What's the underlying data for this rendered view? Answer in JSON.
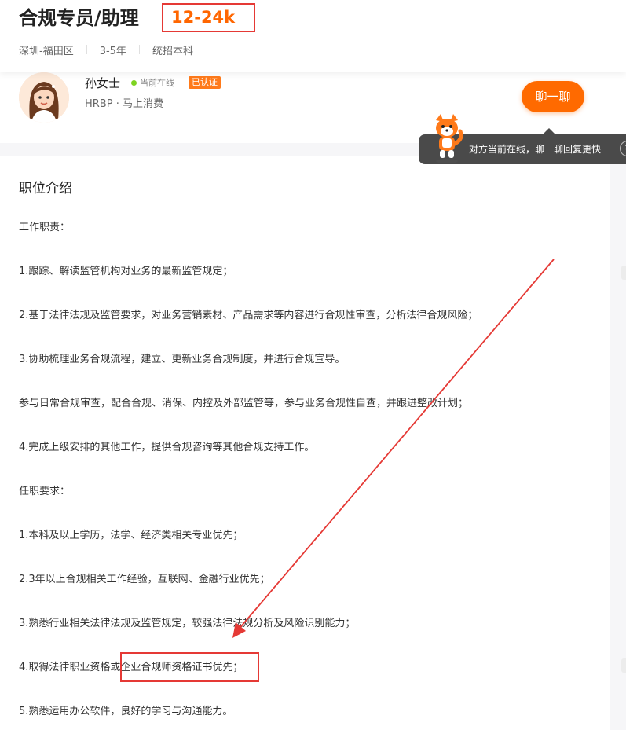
{
  "job": {
    "title": "合规专员/助理",
    "salary": "12-24k",
    "location": "深圳-福田区",
    "experience": "3-5年",
    "education": "统招本科"
  },
  "recruiter": {
    "name": "孙女士",
    "status": "当前在线",
    "verified_badge": "已认证",
    "position_company": "HRBP · 马上消费",
    "chat_button": "聊一聊",
    "tooltip": "对方当前在线，聊一聊回复更快"
  },
  "description": {
    "section_title": "职位介绍",
    "lines": [
      "工作职责：",
      "1.跟踪、解读监管机构对业务的最新监管规定；",
      "2.基于法律法规及监管要求，对业务营销素材、产品需求等内容进行合规性审查，分析法律合规风险；",
      "3.协助梳理业务合规流程，建立、更新业务合规制度，并进行合规宣导。",
      "参与日常合规审查，配合合规、消保、内控及外部监管等，参与业务合规性自查，并跟进整改计划；",
      "4.完成上级安排的其他工作，提供合规咨询等其他合规支持工作。",
      "任职要求：",
      "1.本科及以上学历，法学、经济类相关专业优先；",
      "2.3年以上合规相关工作经验，互联网、金融行业优先；",
      "3.熟悉行业相关法律法规及监管规定，较强法律法规分析及风险识别能力；",
      "4.取得法律职业资格或企业合规师资格证书优先；",
      "5.熟悉运用办公软件，良好的学习与沟通能力。"
    ]
  },
  "colors": {
    "accent": "#ff6600",
    "annotation": "#e53935",
    "online": "#7ed321"
  },
  "icons": {
    "tooltip_close": "close-icon",
    "mascot": "mascot-icon"
  }
}
